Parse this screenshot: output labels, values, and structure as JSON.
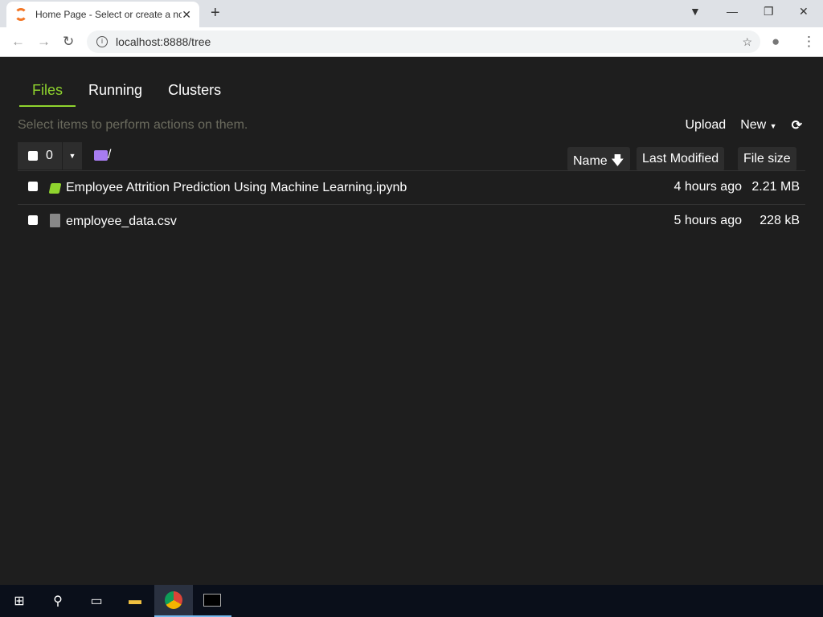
{
  "browser": {
    "tab_title": "Home Page - Select or create a notebook",
    "url": "localhost:8888/tree"
  },
  "tabs": [
    {
      "label": "Files"
    },
    {
      "label": "Running"
    },
    {
      "label": "Clusters"
    }
  ],
  "hint": "Select items to perform actions on them.",
  "actions": {
    "upload": "Upload",
    "new": "New"
  },
  "toolbar": {
    "selected_count": "0",
    "path": "/"
  },
  "columns": {
    "name": "Name",
    "modified": "Last Modified",
    "size": "File size"
  },
  "files": [
    {
      "name": "Employee Attrition Prediction Using Machine Learning.ipynb",
      "modified": "4 hours ago",
      "size": "2.21 MB",
      "icon": "notebook-icon"
    },
    {
      "name": "employee_data.csv",
      "modified": "5 hours ago",
      "size": "228 kB",
      "icon": "file-icon"
    }
  ]
}
